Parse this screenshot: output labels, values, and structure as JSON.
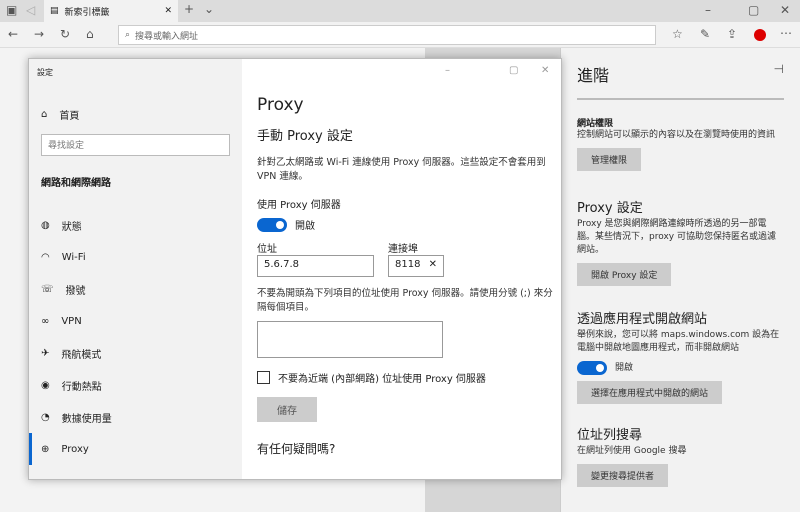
{
  "browser": {
    "tab_title": "新索引標籤",
    "address_placeholder": "搜尋或輸入網址"
  },
  "settings": {
    "window_title": "設定",
    "home": "首頁",
    "search_placeholder": "尋找設定",
    "section": "網路和網際網路",
    "nav": [
      {
        "icon": "globe-status-icon",
        "label": "狀態"
      },
      {
        "icon": "wifi-icon",
        "label": "Wi-Fi"
      },
      {
        "icon": "dialup-icon",
        "label": "撥號"
      },
      {
        "icon": "vpn-icon",
        "label": "VPN"
      },
      {
        "icon": "airplane-icon",
        "label": "飛航模式"
      },
      {
        "icon": "hotspot-icon",
        "label": "行動熱點"
      },
      {
        "icon": "data-usage-icon",
        "label": "數據使用量"
      },
      {
        "icon": "globe-icon",
        "label": "Proxy"
      }
    ],
    "page_title": "Proxy",
    "manual_title": "手動 Proxy 設定",
    "manual_desc": "針對乙太網路或 Wi-Fi 連線使用 Proxy 伺服器。這些設定不會套用到 VPN 連線。",
    "use_proxy_label": "使用 Proxy 伺服器",
    "toggle_state": "開啟",
    "address_label": "位址",
    "address_value": "5.6.7.8",
    "port_label": "連接埠",
    "port_value": "8118",
    "exceptions_desc": "不要為開頭為下列項目的位址使用 Proxy 伺服器。請使用分號 (;) 來分隔每個項目。",
    "local_checkbox": "不要為近端 (內部網路) 位址使用 Proxy 伺服器",
    "save": "儲存",
    "question": "有任何疑問嗎?"
  },
  "panel": {
    "title": "進階",
    "perm_title": "網站權限",
    "perm_desc": "控制網站可以顯示的內容以及在瀏覽時使用的資訊",
    "perm_btn": "管理權限",
    "proxy_title": "Proxy 設定",
    "proxy_desc": "Proxy 是您與網際網路連線時所透過的另一部電腦。某些情況下，proxy 可協助您保持匿名或過濾網站。",
    "proxy_btn": "開啟 Proxy 設定",
    "apps_title": "透過應用程式開啟網站",
    "apps_desc": "舉例來說，您可以將 maps.windows.com 設為在電腦中開啟地圖應用程式，而非開啟網站",
    "apps_toggle": "開啟",
    "apps_btn": "選擇在應用程式中開啟的網站",
    "search_title": "位址列搜尋",
    "search_desc": "在網址列使用 Google 搜尋",
    "search_btn": "變更搜尋提供者"
  }
}
